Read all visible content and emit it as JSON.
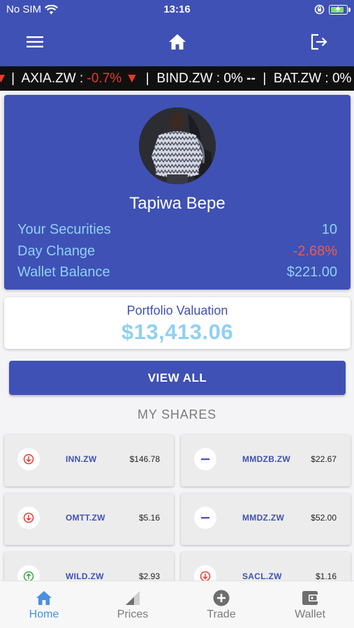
{
  "status_bar": {
    "carrier": "No SIM",
    "time": "13:16"
  },
  "app_bar": {
    "menu_icon": "menu-icon",
    "home_icon": "home-icon",
    "logout_icon": "logout-icon"
  },
  "ticker": {
    "items": [
      {
        "symbol": "AXIA.ZW",
        "change": "-0.7%",
        "arrow": "▼",
        "negative": true
      },
      {
        "symbol": "BIND.ZW",
        "change": "0%",
        "arrow": "--",
        "negative": false
      },
      {
        "symbol": "BAT.ZW",
        "change": "0%",
        "arrow": "",
        "negative": false
      }
    ]
  },
  "profile": {
    "name": "Tapiwa Bepe",
    "stats": [
      {
        "label": "Your Securities",
        "value": "10"
      },
      {
        "label": "Day Change",
        "value": "-2.68%"
      },
      {
        "label": "Wallet Balance",
        "value": "$221.00"
      }
    ]
  },
  "valuation": {
    "label": "Portfolio Valuation",
    "amount": "$13,413.06"
  },
  "view_all_label": "VIEW ALL",
  "shares_title": "MY SHARES",
  "shares": [
    {
      "symbol": "INN.ZW",
      "price": "$146.78",
      "trend": "down"
    },
    {
      "symbol": "MMDZB.ZW",
      "price": "$22.67",
      "trend": "flat"
    },
    {
      "symbol": "OMTT.ZW",
      "price": "$5.16",
      "trend": "down"
    },
    {
      "symbol": "MMDZ.ZW",
      "price": "$52.00",
      "trend": "flat"
    },
    {
      "symbol": "WILD.ZW",
      "price": "$2.93",
      "trend": "up"
    },
    {
      "symbol": "SACL.ZW",
      "price": "$1.16",
      "trend": "down"
    }
  ],
  "bottom_nav": [
    {
      "label": "Home",
      "icon": "home-icon",
      "active": true
    },
    {
      "label": "Prices",
      "icon": "signal-icon",
      "active": false
    },
    {
      "label": "Trade",
      "icon": "add-circle-icon",
      "active": false
    },
    {
      "label": "Wallet",
      "icon": "wallet-icon",
      "active": false
    }
  ],
  "colors": {
    "primary": "#3f51b5",
    "accent_light_blue": "#8fd0f5",
    "negative": "#ef5a4f",
    "down": "#e8392b",
    "up": "#3da24a",
    "active_tab": "#4a8fe0"
  }
}
